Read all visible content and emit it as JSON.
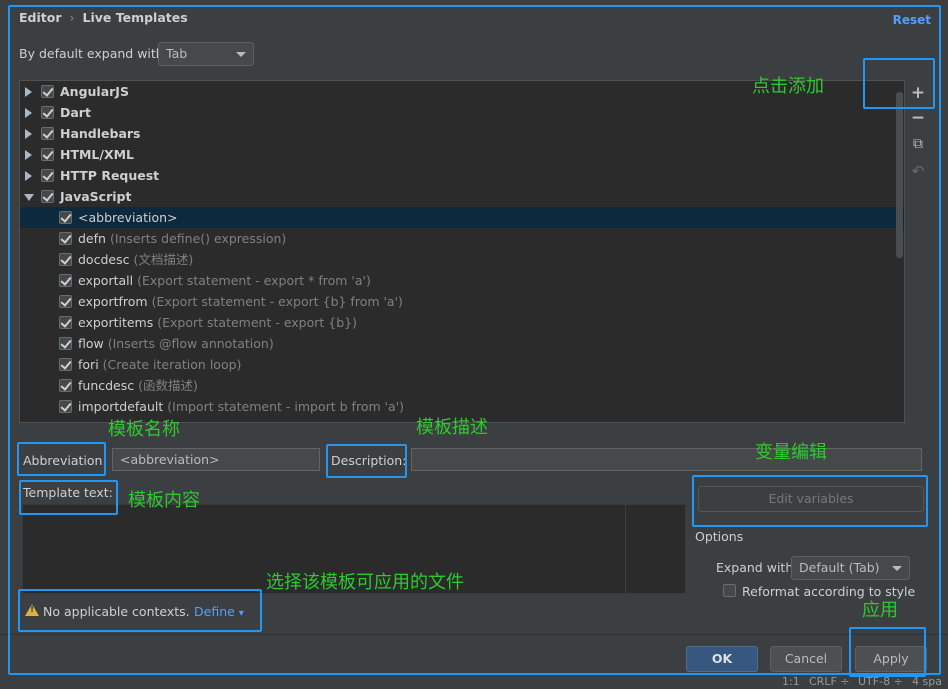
{
  "breadcrumb": {
    "parent": "Editor",
    "current": "Live Templates"
  },
  "header": {
    "reset_label": "Reset"
  },
  "expand_default": {
    "label": "By default expand with",
    "value": "Tab"
  },
  "groups": [
    {
      "name": "AngularJS"
    },
    {
      "name": "Dart"
    },
    {
      "name": "Handlebars"
    },
    {
      "name": "HTML/XML"
    },
    {
      "name": "HTTP Request"
    },
    {
      "name": "JavaScript"
    }
  ],
  "templates": [
    {
      "name": "<abbreviation>",
      "desc": ""
    },
    {
      "name": "defn",
      "desc": "(Inserts define() expression)"
    },
    {
      "name": "docdesc",
      "desc": "(文档描述)"
    },
    {
      "name": "exportall",
      "desc": "(Export statement - export * from 'a')"
    },
    {
      "name": "exportfrom",
      "desc": "(Export statement - export {b} from 'a')"
    },
    {
      "name": "exportitems",
      "desc": "(Export statement - export {b})"
    },
    {
      "name": "flow",
      "desc": "(Inserts @flow annotation)"
    },
    {
      "name": "fori",
      "desc": "(Create iteration loop)"
    },
    {
      "name": "funcdesc",
      "desc": "(函数描述)"
    },
    {
      "name": "importdefault",
      "desc": "(Import statement - import b from 'a')"
    }
  ],
  "toolbar": {
    "add": "+",
    "remove": "−",
    "copy": "⧉",
    "undo": "↶"
  },
  "form": {
    "abbreviation_label": "Abbreviation:",
    "abbreviation_value": "<abbreviation>",
    "description_label": "Description:",
    "description_value": "",
    "template_text_label": "Template text:",
    "edit_variables_label": "Edit variables",
    "options_label": "Options",
    "expand_with_label": "Expand with",
    "expand_with_value": "Default (Tab)",
    "reformat_label": "Reformat according to style",
    "contexts_message": "No applicable contexts.",
    "define_label": "Define"
  },
  "buttons": {
    "ok": "OK",
    "cancel": "Cancel",
    "apply": "Apply"
  },
  "annotations": {
    "add": "点击添加",
    "abbr": "模板名称",
    "desc": "模板描述",
    "vars": "变量编辑",
    "content": "模板内容",
    "context": "选择该模板可应用的文件",
    "apply": "应用"
  },
  "statusbar": {
    "pos": "1:1",
    "line_sep": "CRLF ÷",
    "encoding": "UTF-8 ÷",
    "indent": "4 spa"
  },
  "colors": {
    "accent": "#2196f3",
    "annotation": "#2ec92e",
    "link": "#589df6",
    "selection": "#0d293e"
  }
}
